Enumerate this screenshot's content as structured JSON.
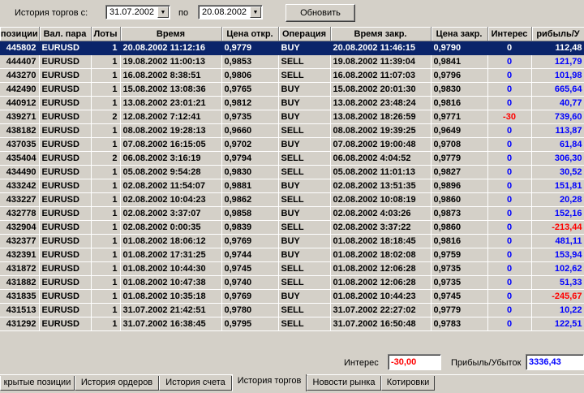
{
  "filter": {
    "from_label": "История торгов с:",
    "from_date": "31.07.2002",
    "to_label": "по",
    "to_date": "20.08.2002",
    "refresh_label": "Обновить"
  },
  "table": {
    "columns": [
      "позиции",
      "Вал. пара",
      "Лоты",
      "Время",
      "Цена откр.",
      "Операция",
      "Время закр.",
      "Цена закр.",
      "Интерес",
      "рибыль/У"
    ],
    "selected_row": 0,
    "rows": [
      [
        "445802",
        "EURUSD",
        "1",
        "20.08.2002 11:12:16",
        "0,9779",
        "BUY",
        "20.08.2002 11:46:15",
        "0,9790",
        "0",
        "112,48"
      ],
      [
        "444407",
        "EURUSD",
        "1",
        "19.08.2002 11:00:13",
        "0,9853",
        "SELL",
        "19.08.2002 11:39:04",
        "0,9841",
        "0",
        "121,79"
      ],
      [
        "443270",
        "EURUSD",
        "1",
        "16.08.2002 8:38:51",
        "0,9806",
        "SELL",
        "16.08.2002 11:07:03",
        "0,9796",
        "0",
        "101,98"
      ],
      [
        "442490",
        "EURUSD",
        "1",
        "15.08.2002 13:08:36",
        "0,9765",
        "BUY",
        "15.08.2002 20:01:30",
        "0,9830",
        "0",
        "665,64"
      ],
      [
        "440912",
        "EURUSD",
        "1",
        "13.08.2002 23:01:21",
        "0,9812",
        "BUY",
        "13.08.2002 23:48:24",
        "0,9816",
        "0",
        "40,77"
      ],
      [
        "439271",
        "EURUSD",
        "2",
        "12.08.2002 7:12:41",
        "0,9735",
        "BUY",
        "13.08.2002 18:26:59",
        "0,9771",
        "-30",
        "739,60"
      ],
      [
        "438182",
        "EURUSD",
        "1",
        "08.08.2002 19:28:13",
        "0,9660",
        "SELL",
        "08.08.2002 19:39:25",
        "0,9649",
        "0",
        "113,87"
      ],
      [
        "437035",
        "EURUSD",
        "1",
        "07.08.2002 16:15:05",
        "0,9702",
        "BUY",
        "07.08.2002 19:00:48",
        "0,9708",
        "0",
        "61,84"
      ],
      [
        "435404",
        "EURUSD",
        "2",
        "06.08.2002 3:16:19",
        "0,9794",
        "SELL",
        "06.08.2002 4:04:52",
        "0,9779",
        "0",
        "306,30"
      ],
      [
        "434490",
        "EURUSD",
        "1",
        "05.08.2002 9:54:28",
        "0,9830",
        "SELL",
        "05.08.2002 11:01:13",
        "0,9827",
        "0",
        "30,52"
      ],
      [
        "433242",
        "EURUSD",
        "1",
        "02.08.2002 11:54:07",
        "0,9881",
        "BUY",
        "02.08.2002 13:51:35",
        "0,9896",
        "0",
        "151,81"
      ],
      [
        "433227",
        "EURUSD",
        "1",
        "02.08.2002 10:04:23",
        "0,9862",
        "SELL",
        "02.08.2002 10:08:19",
        "0,9860",
        "0",
        "20,28"
      ],
      [
        "432778",
        "EURUSD",
        "1",
        "02.08.2002 3:37:07",
        "0,9858",
        "BUY",
        "02.08.2002 4:03:26",
        "0,9873",
        "0",
        "152,16"
      ],
      [
        "432904",
        "EURUSD",
        "1",
        "02.08.2002 0:00:35",
        "0,9839",
        "SELL",
        "02.08.2002 3:37:22",
        "0,9860",
        "0",
        "-213,44"
      ],
      [
        "432377",
        "EURUSD",
        "1",
        "01.08.2002 18:06:12",
        "0,9769",
        "BUY",
        "01.08.2002 18:18:45",
        "0,9816",
        "0",
        "481,11"
      ],
      [
        "432391",
        "EURUSD",
        "1",
        "01.08.2002 17:31:25",
        "0,9744",
        "BUY",
        "01.08.2002 18:02:08",
        "0,9759",
        "0",
        "153,94"
      ],
      [
        "431872",
        "EURUSD",
        "1",
        "01.08.2002 10:44:30",
        "0,9745",
        "SELL",
        "01.08.2002 12:06:28",
        "0,9735",
        "0",
        "102,62"
      ],
      [
        "431882",
        "EURUSD",
        "1",
        "01.08.2002 10:47:38",
        "0,9740",
        "SELL",
        "01.08.2002 12:06:28",
        "0,9735",
        "0",
        "51,33"
      ],
      [
        "431835",
        "EURUSD",
        "1",
        "01.08.2002 10:35:18",
        "0,9769",
        "BUY",
        "01.08.2002 10:44:23",
        "0,9745",
        "0",
        "-245,67"
      ],
      [
        "431513",
        "EURUSD",
        "1",
        "31.07.2002 21:42:51",
        "0,9780",
        "SELL",
        "31.07.2002 22:27:02",
        "0,9779",
        "0",
        "10,22"
      ],
      [
        "431292",
        "EURUSD",
        "1",
        "31.07.2002 16:38:45",
        "0,9795",
        "SELL",
        "31.07.2002 16:50:48",
        "0,9783",
        "0",
        "122,51"
      ]
    ]
  },
  "summary": {
    "interest_label": "Интерес",
    "interest_value": "-30,00",
    "profit_label": "Прибыль/Убыток",
    "profit_value": "3336,43"
  },
  "tabs": [
    "крытые позиции",
    "История ордеров",
    "История счета",
    "История торгов",
    "Новости рынка",
    "Котировки"
  ],
  "active_tab": 3,
  "colors": {
    "selection": "#0a246a",
    "positive": "#0000ff",
    "negative": "#ff0000",
    "face": "#d4d0c8"
  }
}
